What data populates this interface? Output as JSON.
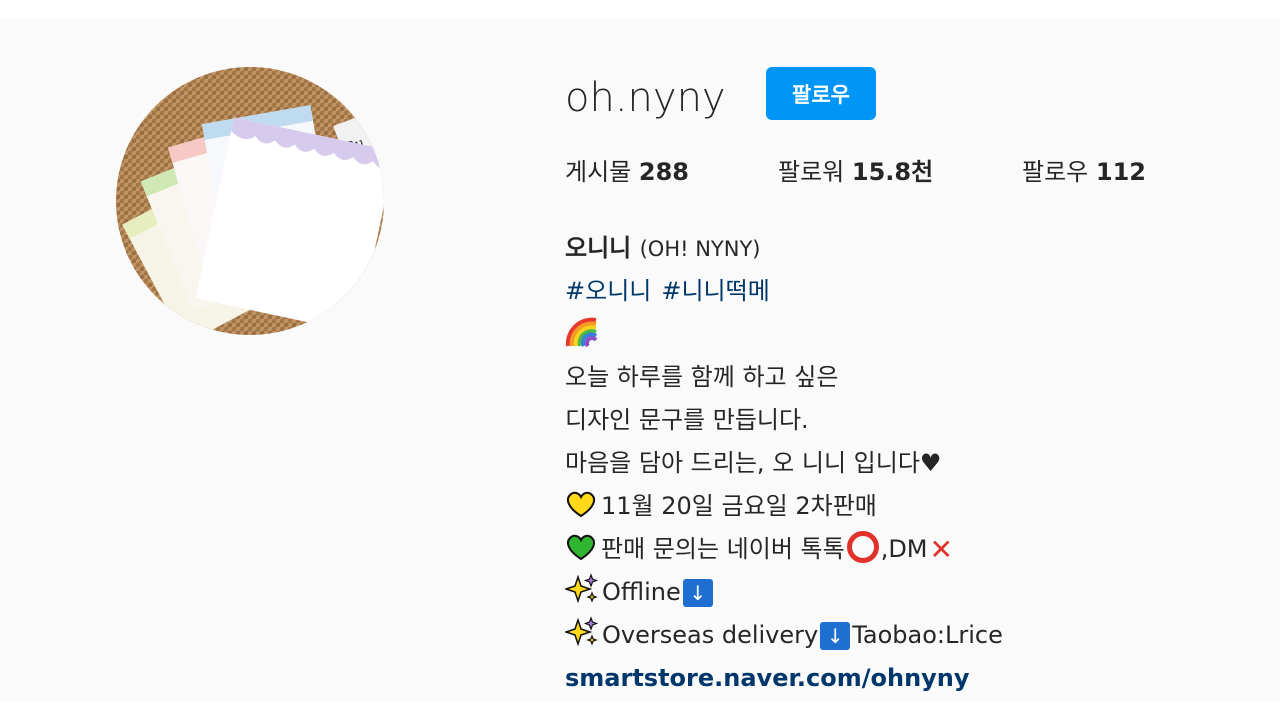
{
  "profile": {
    "username": "oh.nyny",
    "follow_button_label": "팔로우"
  },
  "stats": {
    "posts": {
      "label": "게시물",
      "value": "288"
    },
    "followers": {
      "label": "팔로워",
      "value": "15.8천"
    },
    "following": {
      "label": "팔로우",
      "value": "112"
    }
  },
  "bio": {
    "full_name": "오니니",
    "full_name_sub": "(OH! NYNY)",
    "hashtags": [
      "#오니니",
      "#니니떡메"
    ],
    "line1": "오늘 하루를 함께 하고 싶은",
    "line2": "디자인 문구를 만듭니다.",
    "line3": "마음을 담아 드리는, 오 니니 입니다♥",
    "line4": "11월 20일 금요일 2차판매",
    "line5": "판매 문의는 네이버 톡톡",
    "line5_after": ",DM",
    "line6": "Offline",
    "line7a": "Overseas delivery",
    "line7b": "Taobao:Lrice",
    "arrow_glyph": "↓",
    "link": "smartstore.naver.com/ohnyny"
  },
  "icons": {
    "rainbow": "rainbow-icon",
    "yellow_heart": "yellow-heart-icon",
    "green_heart": "green-heart-icon",
    "sparkles": "sparkles-icon",
    "circle": "red-circle-icon",
    "cross": "cross-mark-icon",
    "down_arrow": "down-arrow-icon"
  },
  "colors": {
    "follow_button": "#0095f6",
    "link": "#00376b",
    "background": "#fafafa"
  }
}
